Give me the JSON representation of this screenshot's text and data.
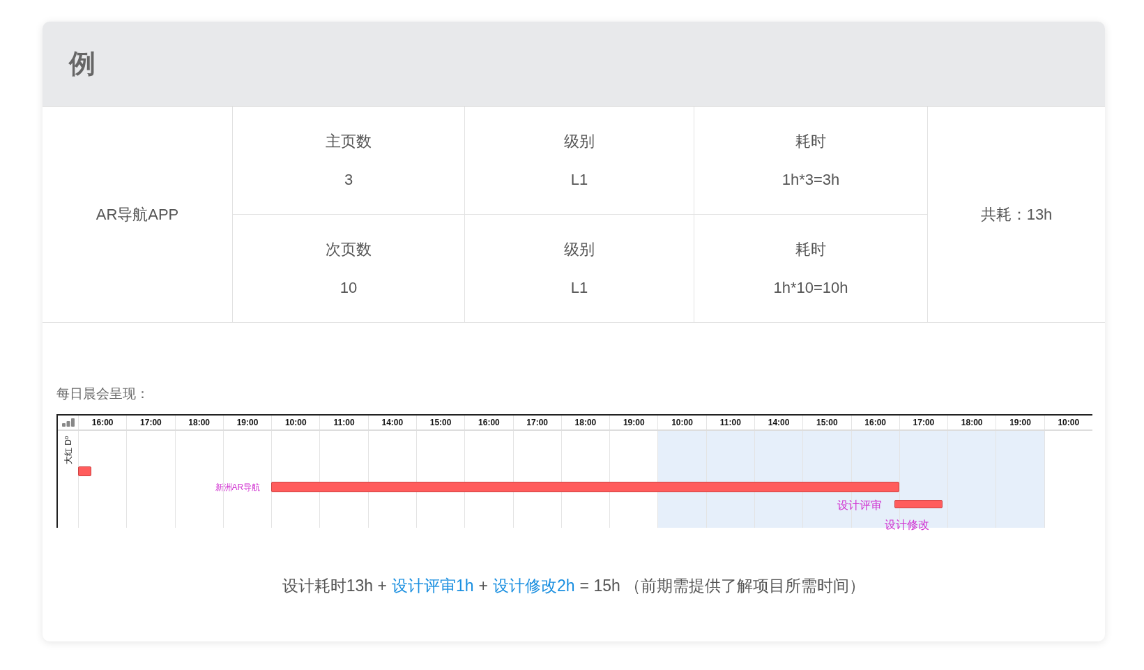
{
  "card": {
    "title": "例"
  },
  "table": {
    "project": "AR导航APP",
    "rows": [
      {
        "cells": [
          {
            "label": "主页数",
            "value": "3"
          },
          {
            "label": "级别",
            "value": "L1"
          },
          {
            "label": "耗时",
            "value": "1h*3=3h"
          }
        ]
      },
      {
        "cells": [
          {
            "label": "次页数",
            "value": "10"
          },
          {
            "label": "级别",
            "value": "L1"
          },
          {
            "label": "耗时",
            "value": "1h*10=10h"
          }
        ]
      }
    ],
    "total": "共耗：13h"
  },
  "section_label": "每日晨会呈现：",
  "gantt": {
    "row_label": "大红 Dº",
    "columns": [
      {
        "time": "16:00",
        "shaded": false
      },
      {
        "time": "17:00",
        "shaded": false
      },
      {
        "time": "18:00",
        "shaded": false
      },
      {
        "time": "19:00",
        "shaded": false
      },
      {
        "time": "10:00",
        "shaded": false
      },
      {
        "time": "11:00",
        "shaded": false
      },
      {
        "time": "14:00",
        "shaded": false
      },
      {
        "time": "15:00",
        "shaded": false
      },
      {
        "time": "16:00",
        "shaded": false
      },
      {
        "time": "17:00",
        "shaded": false
      },
      {
        "time": "18:00",
        "shaded": false
      },
      {
        "time": "19:00",
        "shaded": false
      },
      {
        "time": "10:00",
        "shaded": true
      },
      {
        "time": "11:00",
        "shaded": true
      },
      {
        "time": "14:00",
        "shaded": true
      },
      {
        "time": "15:00",
        "shaded": true
      },
      {
        "time": "16:00",
        "shaded": true
      },
      {
        "time": "17:00",
        "shaded": true
      },
      {
        "time": "18:00",
        "shaded": true
      },
      {
        "time": "19:00",
        "shaded": true
      },
      {
        "time": "10:00",
        "shaded": false
      }
    ],
    "tasks": [
      {
        "kind": "marker"
      },
      {
        "kind": "bar",
        "label": "新洲AR导航"
      },
      {
        "kind": "bar",
        "label": "设计评审",
        "note": "设计修改"
      }
    ]
  },
  "formula": [
    {
      "text": "设计耗时13h +",
      "highlighted": false
    },
    {
      "text": "设计评审1h",
      "highlighted": true
    },
    {
      "text": "+",
      "highlighted": false
    },
    {
      "text": "设计修改2h",
      "highlighted": true
    },
    {
      "text": "= 15h （前期需提供了解项目所需时间）",
      "highlighted": false
    }
  ]
}
